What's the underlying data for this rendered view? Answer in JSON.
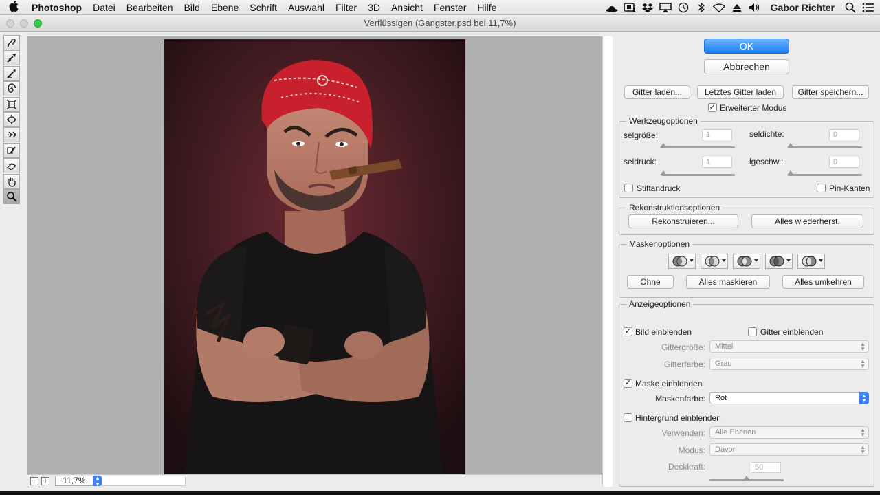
{
  "menubar": {
    "app": "Photoshop",
    "items": [
      "Datei",
      "Bearbeiten",
      "Bild",
      "Ebene",
      "Schrift",
      "Auswahl",
      "Filter",
      "3D",
      "Ansicht",
      "Fenster",
      "Hilfe"
    ],
    "user": "Gabor Richter",
    "status_icons": [
      "bowler-hat-icon",
      "creative-cloud-icon",
      "dropbox-icon",
      "airplay-icon",
      "time-machine-icon",
      "bluetooth-icon",
      "wifi-icon",
      "eject-icon",
      "volume-icon"
    ]
  },
  "window": {
    "title": "Verflüssigen (Gangster.psd bei 11,7%)"
  },
  "tools": [
    "forward-warp-tool-icon",
    "reconstruct-tool-icon",
    "smooth-tool-icon",
    "twirl-tool-icon",
    "pucker-tool-icon",
    "bloat-tool-icon",
    "push-left-tool-icon",
    "freeze-mask-tool-icon",
    "thaw-mask-tool-icon",
    "hand-tool-icon",
    "zoom-tool-icon"
  ],
  "statusbar": {
    "zoom": "11,7%",
    "zoom_out": "−",
    "zoom_in": "+"
  },
  "panel": {
    "ok": "OK",
    "cancel": "Abbrechen",
    "load_mesh": "Gitter laden...",
    "load_last_mesh": "Letztes Gitter laden",
    "save_mesh": "Gitter speichern...",
    "advanced_mode": "Erweiterter Modus",
    "tool_options": {
      "title": "Werkzeugoptionen",
      "brush_size": "selgröße:",
      "brush_size_value": "1",
      "brush_density": "seldichte:",
      "brush_density_value": "0",
      "brush_pressure": "seldruck:",
      "brush_pressure_value": "1",
      "brush_rate": "lgeschw.:",
      "brush_rate_value": "0",
      "stylus_pressure": "Stiftandruck",
      "pin_edges": "Pin-Kanten"
    },
    "reconstruct_options": {
      "title": "Rekonstruktionsoptionen",
      "reconstruct": "Rekonstruieren...",
      "restore_all": "Alles wiederherst."
    },
    "mask_options": {
      "title": "Maskenoptionen",
      "none": "Ohne",
      "mask_all": "Alles maskieren",
      "invert_all": "Alles umkehren"
    },
    "view_options": {
      "title": "Anzeigeoptionen",
      "show_image": "Bild einblenden",
      "show_mesh": "Gitter einblenden",
      "mesh_size_label": "Gittergröße:",
      "mesh_size": "Mittel",
      "mesh_color_label": "Gitterfarbe:",
      "mesh_color": "Grau",
      "show_mask": "Maske einblenden",
      "mask_color_label": "Maskenfarbe:",
      "mask_color": "Rot",
      "show_backdrop": "Hintergrund einblenden",
      "use_label": "Verwenden:",
      "use": "Alle Ebenen",
      "mode_label": "Modus:",
      "mode": "Davor",
      "opacity_label": "Deckkraft:",
      "opacity": "50"
    }
  },
  "colors": {
    "ok_button": "#1a7ff7",
    "mask_color_select": "#3b82f6",
    "bandana": "#c8202c",
    "canvas_bg": "#b0b0b0"
  }
}
